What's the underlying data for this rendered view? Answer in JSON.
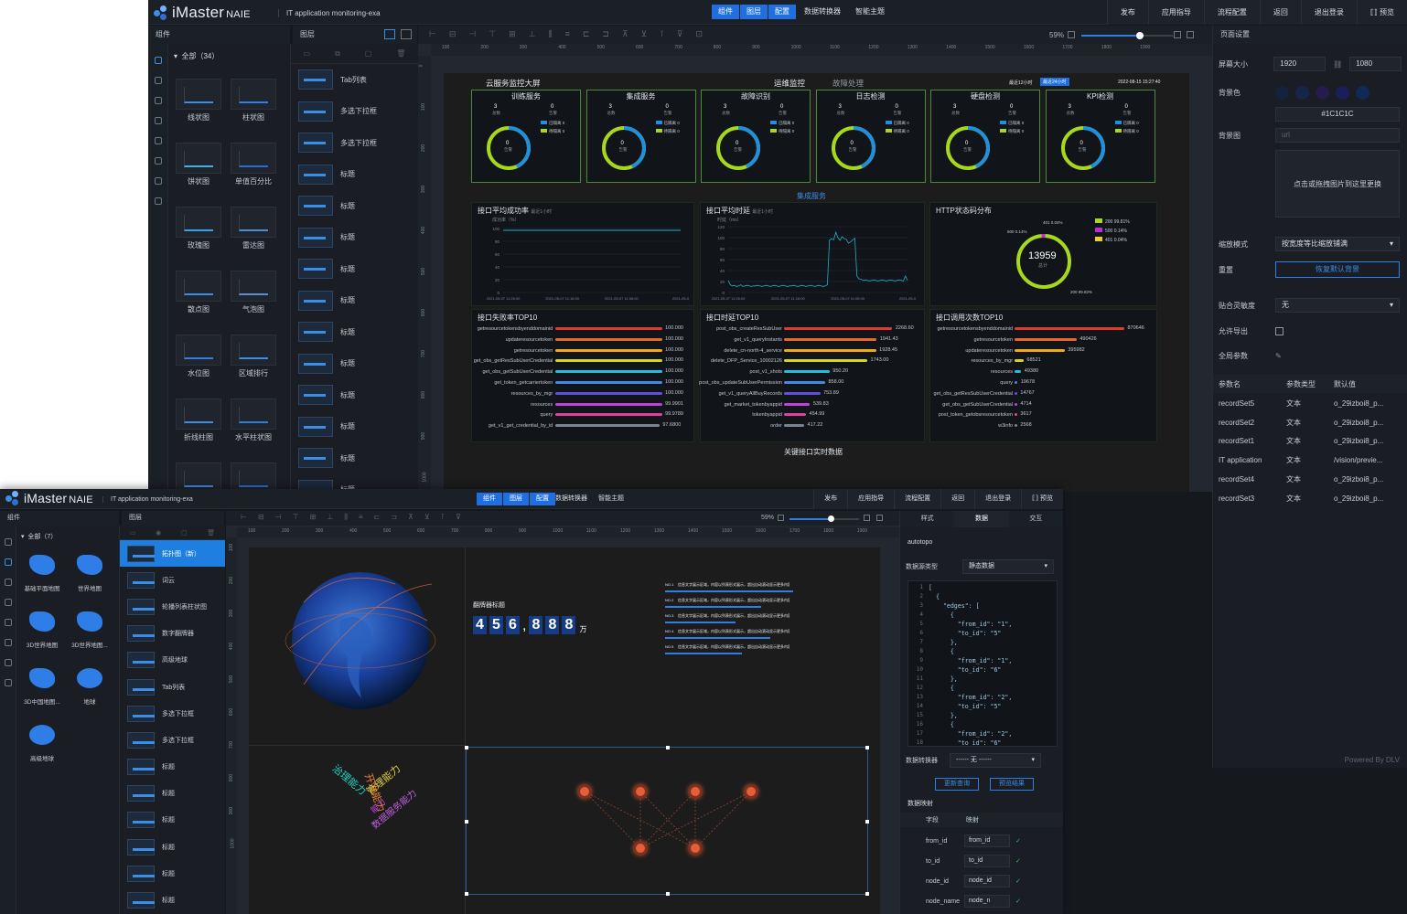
{
  "w1": {
    "app_name": "iMaster",
    "app_suffix": "NAIE",
    "subtitle": "IT application monitoring-exa",
    "modes": [
      "组件",
      "图层",
      "配置"
    ],
    "menus": [
      "数据转换器",
      "智能主题"
    ],
    "right_menus": [
      "发布",
      "应用指导",
      "流程配置",
      "返回",
      "退出登录",
      "⟦⟧ 预览"
    ],
    "components_header": "组件",
    "all_label": "全部（34）",
    "components": [
      "线状图",
      "柱状图",
      "饼状图",
      "单值百分比",
      "玫瑰图",
      "雷达图",
      "散点图",
      "气泡图",
      "水位图",
      "区域排行",
      "折线柱图",
      "水平柱状图",
      "",
      ""
    ],
    "layers_header": "图层",
    "layers": [
      "Tab列表",
      "多选下拉框",
      "多选下拉框",
      "标题",
      "标题",
      "标题",
      "标题",
      "标题",
      "标题",
      "标题",
      "标题",
      "标题",
      "标题",
      "标题"
    ],
    "zoom": "59%",
    "ruler_ticks": [
      "100",
      "200",
      "300",
      "400",
      "500",
      "600",
      "700",
      "800",
      "900",
      "1000",
      "1100",
      "1200",
      "1300",
      "1400",
      "1500",
      "1600",
      "1700",
      "1800",
      "1900"
    ],
    "vruler_ticks": [
      "0",
      "100",
      "200",
      "300",
      "400",
      "500",
      "600",
      "700",
      "800",
      "900",
      "1000"
    ],
    "dashboard": {
      "title_left": "云服务监控大屏",
      "title_mid": "运维监控",
      "title_mid2": "故障处理",
      "badge1": "最近12小时",
      "badge2": "最近24小时",
      "datetime": "2022-08-15 15:27:40",
      "services": [
        "训练服务",
        "集成服务",
        "故障识别",
        "日志检测",
        "硬盘检测",
        "KPI检测"
      ],
      "svc_total": "3",
      "svc_total_label": "总数",
      "svc_alarm": "0",
      "svc_alarm_label": "告警",
      "svc_center": "0",
      "svc_center_label": "告警",
      "svc_legend": [
        "已隔离 0",
        "待隔离 0"
      ],
      "section_title": "集成服务",
      "p1_title": "接口平均成功率",
      "p1_sub": "最近1小时",
      "p1_unit": "成功率（%）",
      "p1_yticks": [
        "100",
        "80",
        "60",
        "40",
        "20",
        "0"
      ],
      "p1_xticks": [
        "2021-05-07 11:26:00",
        "2021-05-07 11:16:00",
        "2021-05-07 11:06:00",
        "2021-05-0"
      ],
      "p2_title": "接口平均时延",
      "p2_sub": "最近1小时",
      "p2_unit": "时延（ms）",
      "p2_yticks": [
        "120",
        "100",
        "80",
        "60",
        "40",
        "20",
        "0"
      ],
      "p2_xticks": [
        "2021-05-07 11:26:00",
        "2021-05-07 11:16:00",
        "2021-05-07 11:06:00",
        "2021-05-0"
      ],
      "p3_title": "HTTP状态码分布",
      "p3_center": "13959",
      "p3_center_label": "总计",
      "p3_labels": [
        "401 0.04%",
        "500 0.14%",
        "200 99.82%"
      ],
      "p3_legend": [
        "200 99.81%",
        "500 0.14%",
        "401 0.04%"
      ],
      "p4_title": "接口失败率TOP10",
      "p4_rows": [
        {
          "n": "getresourcetokensbyenddomainid",
          "v": "100.000"
        },
        {
          "n": "updateresourcetoken",
          "v": "100.000"
        },
        {
          "n": "getresourcetoken",
          "v": "100.000"
        },
        {
          "n": "get_obs_getResSubUserCredential",
          "v": "100.000"
        },
        {
          "n": "get_obs_getSubUserCredential",
          "v": "100.000"
        },
        {
          "n": "get_token_getcarriertoken",
          "v": "100.000"
        },
        {
          "n": "resources_by_mgr",
          "v": "100.000"
        },
        {
          "n": "resources",
          "v": "99.9901"
        },
        {
          "n": "query",
          "v": "99.9789"
        },
        {
          "n": "get_v1_get_credential_by_id",
          "v": "97.6800"
        }
      ],
      "p5_title": "接口时延TOP10",
      "p5_rows": [
        {
          "n": "post_obs_createResSubUser",
          "v": "2268.60"
        },
        {
          "n": "get_v1_queryInstants",
          "v": "1941.43"
        },
        {
          "n": "delete_cn-north-4_service",
          "v": "1928.45"
        },
        {
          "n": "delete_DFP_Service_10002126",
          "v": "1743.00"
        },
        {
          "n": "post_v1_shots",
          "v": "950.20"
        },
        {
          "n": "post_obs_updateSubUserPermission",
          "v": "858.00"
        },
        {
          "n": "get_v1_queryAllBuyRecords",
          "v": "753.89"
        },
        {
          "n": "get_market_tokenbyappid",
          "v": "539.83"
        },
        {
          "n": "tokenbyappid",
          "v": "454.99"
        },
        {
          "n": "order",
          "v": "417.22"
        }
      ],
      "p6_title": "接口调用次数TOP10",
      "p6_rows": [
        {
          "n": "getresourcetokensbyenddomainid",
          "v": "870646"
        },
        {
          "n": "getresourcetoken",
          "v": "490426"
        },
        {
          "n": "updateresourcetoken",
          "v": "395982"
        },
        {
          "n": "resources_by_mgr",
          "v": "68521"
        },
        {
          "n": "resources",
          "v": "49380"
        },
        {
          "n": "query",
          "v": "19678"
        },
        {
          "n": "get_obs_getResSubUserCredential",
          "v": "14767"
        },
        {
          "n": "get_obs_getSubUserCredential",
          "v": "4714"
        },
        {
          "n": "post_token_getobsresourcetoken",
          "v": "3617"
        },
        {
          "n": "w3info",
          "v": "2568"
        }
      ],
      "footer_title": "关键接口实时数据"
    },
    "right_panel": {
      "header": "页面设置",
      "screen_size_label": "屏幕大小",
      "width": "1920",
      "height": "1080",
      "bg_color_label": "背景色",
      "bg_color_value": "#1C1C1C",
      "bg_image_label": "背景图",
      "bg_image_placeholder": "url",
      "upload_text": "点击或拖拽图片到这里更换",
      "scale_label": "缩放模式",
      "scale_value": "按宽度等比缩放铺满",
      "reset_label": "重置",
      "reset_button": "恢复默认背景",
      "snap_label": "贴合灵敏度",
      "snap_value": "无",
      "export_label": "允许导出",
      "global_label": "全局参数",
      "param_headers": [
        "参数名",
        "参数类型",
        "默认值"
      ],
      "params": [
        [
          "recordSet5",
          "文本",
          "o_29izboi8_p..."
        ],
        [
          "recordSet2",
          "文本",
          "o_29izboi8_p..."
        ],
        [
          "recordSet1",
          "文本",
          "o_29izboi8_p..."
        ],
        [
          "IT application",
          "文本",
          "/vision/previe..."
        ],
        [
          "recordSet4",
          "文本",
          "o_29izboi8_p..."
        ],
        [
          "recordSet3",
          "文本",
          "o_29izboi8_p..."
        ]
      ],
      "powered": "Powered By DLV"
    }
  },
  "w2": {
    "app_name": "iMaster",
    "app_suffix": "NAIE",
    "subtitle": "IT application monitoring-exa",
    "modes": [
      "组件",
      "图层",
      "配置"
    ],
    "menus": [
      "数据转换器",
      "智能主题"
    ],
    "right_menus": [
      "发布",
      "应用指导",
      "流程配置",
      "返回",
      "退出登录",
      "⟦⟧ 预览"
    ],
    "components_header": "组件",
    "all_label": "全部（7）",
    "components": [
      "基础平面地图",
      "世界地图",
      "3D世界地图",
      "3D世界地图...",
      "3D中国地图...",
      "地球",
      "高级地球"
    ],
    "layers_header": "图层",
    "layers": [
      "拓扑图（新）",
      "词云",
      "轮播列表柱状图",
      "数字翻牌器",
      "高级地球",
      "Tab列表",
      "多选下拉框",
      "多选下拉框",
      "标题",
      "标题",
      "标题",
      "标题",
      "标题",
      "标题"
    ],
    "zoom": "59%",
    "ruler_ticks": [
      "100",
      "200",
      "300",
      "400",
      "500",
      "600",
      "700",
      "800",
      "900",
      "1000",
      "1100",
      "1200",
      "1300",
      "1400",
      "1500",
      "1600",
      "1700",
      "1800",
      "1900"
    ],
    "vruler_ticks": [
      "100",
      "200",
      "300",
      "400",
      "500",
      "600",
      "700",
      "800",
      "900",
      "1000"
    ],
    "flipper_title": "翻牌器标题",
    "flipper_digits": [
      "4",
      "5",
      "6",
      ",",
      "8",
      "8",
      "8"
    ],
    "flipper_unit": "万",
    "list_rows": [
      "NO.1",
      "NO.2",
      "NO.3",
      "NO.4",
      "NO.5"
    ],
    "list_text": "信息文字展示区域，内容以列表形式展示，超出自动滚动显示更多内容",
    "word_cloud": [
      "治理能力",
      "开发能力",
      "管理能力",
      "能力",
      "数据服务能力"
    ],
    "tabs": [
      "样式",
      "数据",
      "交互"
    ],
    "comp_name": "autotopo",
    "ds_type_label": "数据源类型",
    "ds_type_value": "静态数据",
    "code_lines": [
      "[",
      "  {",
      "    \"edges\": [",
      "      {",
      "        \"from_id\": \"1\",",
      "        \"to_id\": \"5\"",
      "      },",
      "      {",
      "        \"from_id\": \"1\",",
      "        \"to_id\": \"6\"",
      "      },",
      "      {",
      "        \"from_id\": \"2\",",
      "        \"to_id\": \"5\"",
      "      },",
      "      {",
      "        \"from_id\": \"2\",",
      "        \"to_id\": \"6\""
    ],
    "converter_label": "数据转换器",
    "converter_value": "------ 无 ------",
    "btn_update": "更新查询",
    "btn_preview": "预览结果",
    "mapping_label": "数据映射",
    "map_headers": [
      "字段",
      "映射"
    ],
    "mappings": [
      [
        "from_id",
        "from_id"
      ],
      [
        "to_id",
        "to_id"
      ],
      [
        "node_id",
        "node_id"
      ],
      [
        "node_name",
        "node_n"
      ]
    ]
  }
}
